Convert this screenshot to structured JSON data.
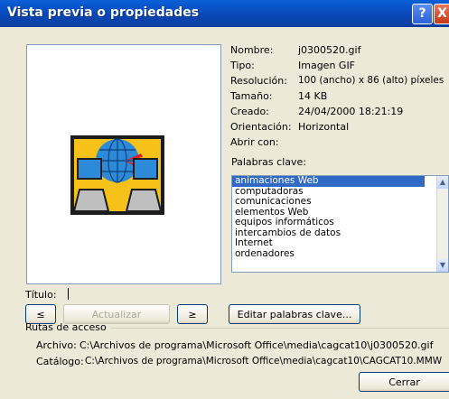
{
  "window": {
    "title": "Vista previa o propiedades"
  },
  "props": [
    {
      "label": "Nombre:",
      "value": "j0300520.gif"
    },
    {
      "label": "Tipo:",
      "value": "Imagen GIF"
    },
    {
      "label": "Resolución:",
      "value": "100 (ancho) x 86 (alto) píxeles"
    },
    {
      "label": "Tamaño:",
      "value": "14 KB"
    },
    {
      "label": "Creado:",
      "value": "24/04/2000 18:21:19"
    },
    {
      "label": "Orientación:",
      "value": "Horizontal"
    },
    {
      "label": "Abrir con:",
      "value": ""
    }
  ],
  "keywords": {
    "label": "Palabras clave:",
    "items": [
      "animaciones Web",
      "computadoras",
      "comunicaciones",
      "elementos Web",
      "equipos informáticos",
      "intercambios de datos",
      "Internet",
      "ordenadores"
    ],
    "selected_index": 0
  },
  "title_field": {
    "label": "Título:",
    "value": ""
  },
  "buttons": {
    "prev": "≤",
    "update": "Actualizar",
    "next": "≥",
    "edit_keywords": "Editar palabras clave...",
    "close": "Cerrar"
  },
  "paths": {
    "group_label": "Rutas de acceso",
    "archivo_label": "Archivo:",
    "archivo_value": "C:\\Archivos de programa\\Microsoft Office\\media\\cagcat10\\j0300520.gif",
    "catalogo_label": "Catálogo:",
    "catalogo_value": "C:\\Archivos de programa\\Microsoft Office\\media\\cagcat10\\CAGCAT10.MMW"
  },
  "icons": {
    "help": "?",
    "close": "X"
  }
}
